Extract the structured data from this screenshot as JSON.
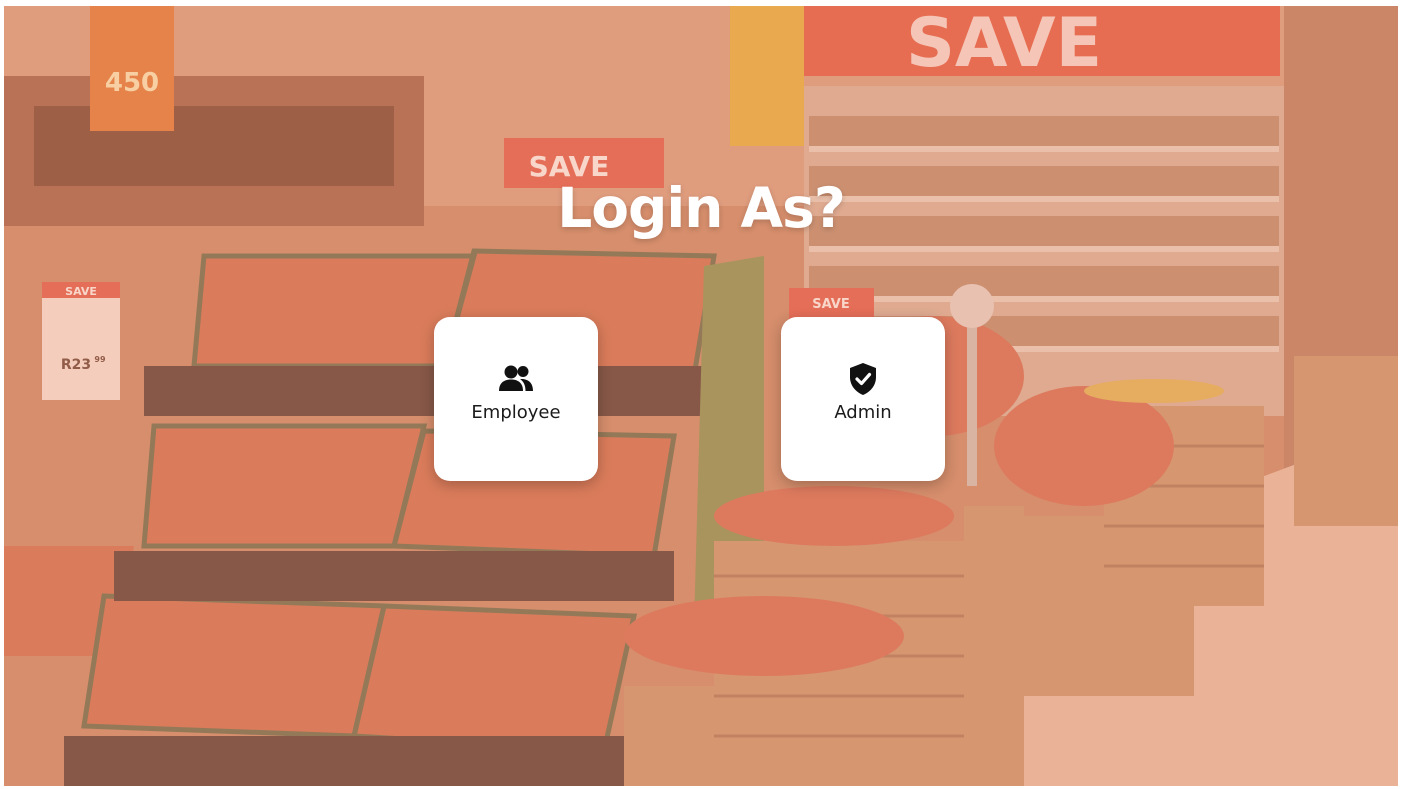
{
  "page": {
    "title": "Login As?"
  },
  "options": [
    {
      "label": "Employee",
      "icon": "users-icon"
    },
    {
      "label": "Admin",
      "icon": "shield-check-icon"
    }
  ],
  "background": {
    "scene": "supermarket-produce-aisle",
    "signs": {
      "save_banner": "SAVE",
      "save_sign_1": "SAVE",
      "save_sign_2": "SAVE",
      "small_save": "SAVE",
      "price": "R23",
      "price_cents": "99",
      "price_top": "450"
    }
  },
  "colors": {
    "overlay": "#EC9270",
    "card": "#FFFFFF",
    "title": "#FFFFFF",
    "text": "#1B1B1B"
  }
}
